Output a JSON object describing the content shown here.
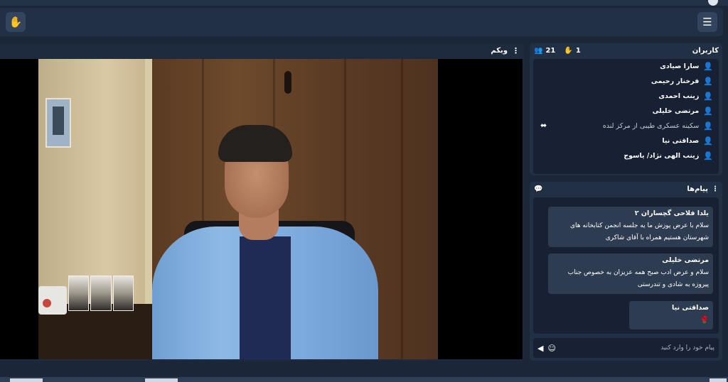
{
  "topbar": {
    "hand_icon": "raise-hand-icon",
    "menu_icon": "hamburger-menu-icon"
  },
  "webcam": {
    "title": "وبکم",
    "menu_icon": "kebab-menu-icon"
  },
  "users_panel": {
    "title": "کاربران",
    "user_count": "21",
    "raised_hands": "1",
    "users": [
      {
        "name": "سارا صیادی",
        "dim": false
      },
      {
        "name": "فرخنار رحیمی",
        "dim": false
      },
      {
        "name": "زینب احمدی",
        "dim": false
      },
      {
        "name": "مرتضی خلیلی",
        "dim": false
      },
      {
        "name": "سکینه عسکری طیبی از مرکز لنده",
        "dim": true
      },
      {
        "name": "صداقتی نیا",
        "dim": false
      },
      {
        "name": "زینب الهی نژاد/ یاسوج",
        "dim": false
      }
    ]
  },
  "messages_panel": {
    "title": "پیام‌ها",
    "messages": [
      {
        "sender": "یلدا فلاحی گچساران ۲",
        "text": "سلام با عرض پوزش ما یه جلسه انجمن کتابخانه های شهرستان هستیم همراه با آقای شاکری"
      },
      {
        "sender": "مرتضی خلیلی",
        "text": "سلام و عرض ادب صبح همه عزیزان به خصوص جناب پیروزه به شادی و تندرستی"
      },
      {
        "sender": "صداقتی نیا",
        "text": "🌹"
      }
    ],
    "input_placeholder": "پیام خود را وارد کنید"
  }
}
